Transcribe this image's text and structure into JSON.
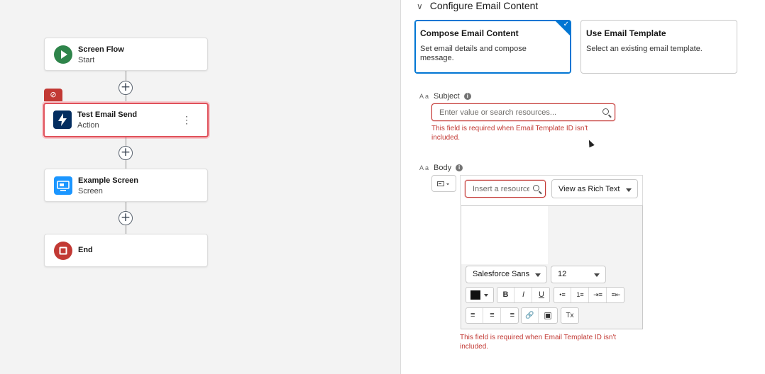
{
  "canvas": {
    "nodes": [
      {
        "title": "Screen Flow",
        "subtitle": "Start"
      },
      {
        "title": "Test Email Send",
        "subtitle": "Action"
      },
      {
        "title": "Example Screen",
        "subtitle": "Screen"
      },
      {
        "title": "End",
        "subtitle": ""
      }
    ],
    "plus_label": "+",
    "kebab": "⋮",
    "error_badge_icon": "⊘"
  },
  "panel": {
    "section_title": "Configure Email Content",
    "options": [
      {
        "title": "Compose Email Content",
        "description": "Set email details and compose message.",
        "selected": true
      },
      {
        "title": "Use Email Template",
        "description": "Select an existing email template.",
        "selected": false
      }
    ],
    "subject": {
      "type_icon": "A a",
      "label": "Subject",
      "info": "i",
      "placeholder": "Enter value or search resources...",
      "error": "This field is required when Email Template ID isn't included."
    },
    "body": {
      "type_icon": "A a",
      "label": "Body",
      "info": "i",
      "resource_placeholder": "Insert a resource",
      "view_mode": "View as Rich Text",
      "font_family": "Salesforce Sans",
      "font_size": "12",
      "toolbar_row2": [
        "B",
        "I",
        "U",
        "•≡",
        "1≡",
        "⇥≡",
        "≡⇤"
      ],
      "toolbar_row3": [
        "≡",
        "≡",
        "≡",
        "🔗",
        "▣",
        "Tx"
      ],
      "error": "This field is required when Email Template ID isn't included."
    }
  },
  "colors": {
    "accent": "#0176d3",
    "error": "#c23934",
    "start_green": "#2e844a",
    "action_navy": "#032d60",
    "screen_blue": "#1b96ff",
    "end_red": "#c23934"
  }
}
